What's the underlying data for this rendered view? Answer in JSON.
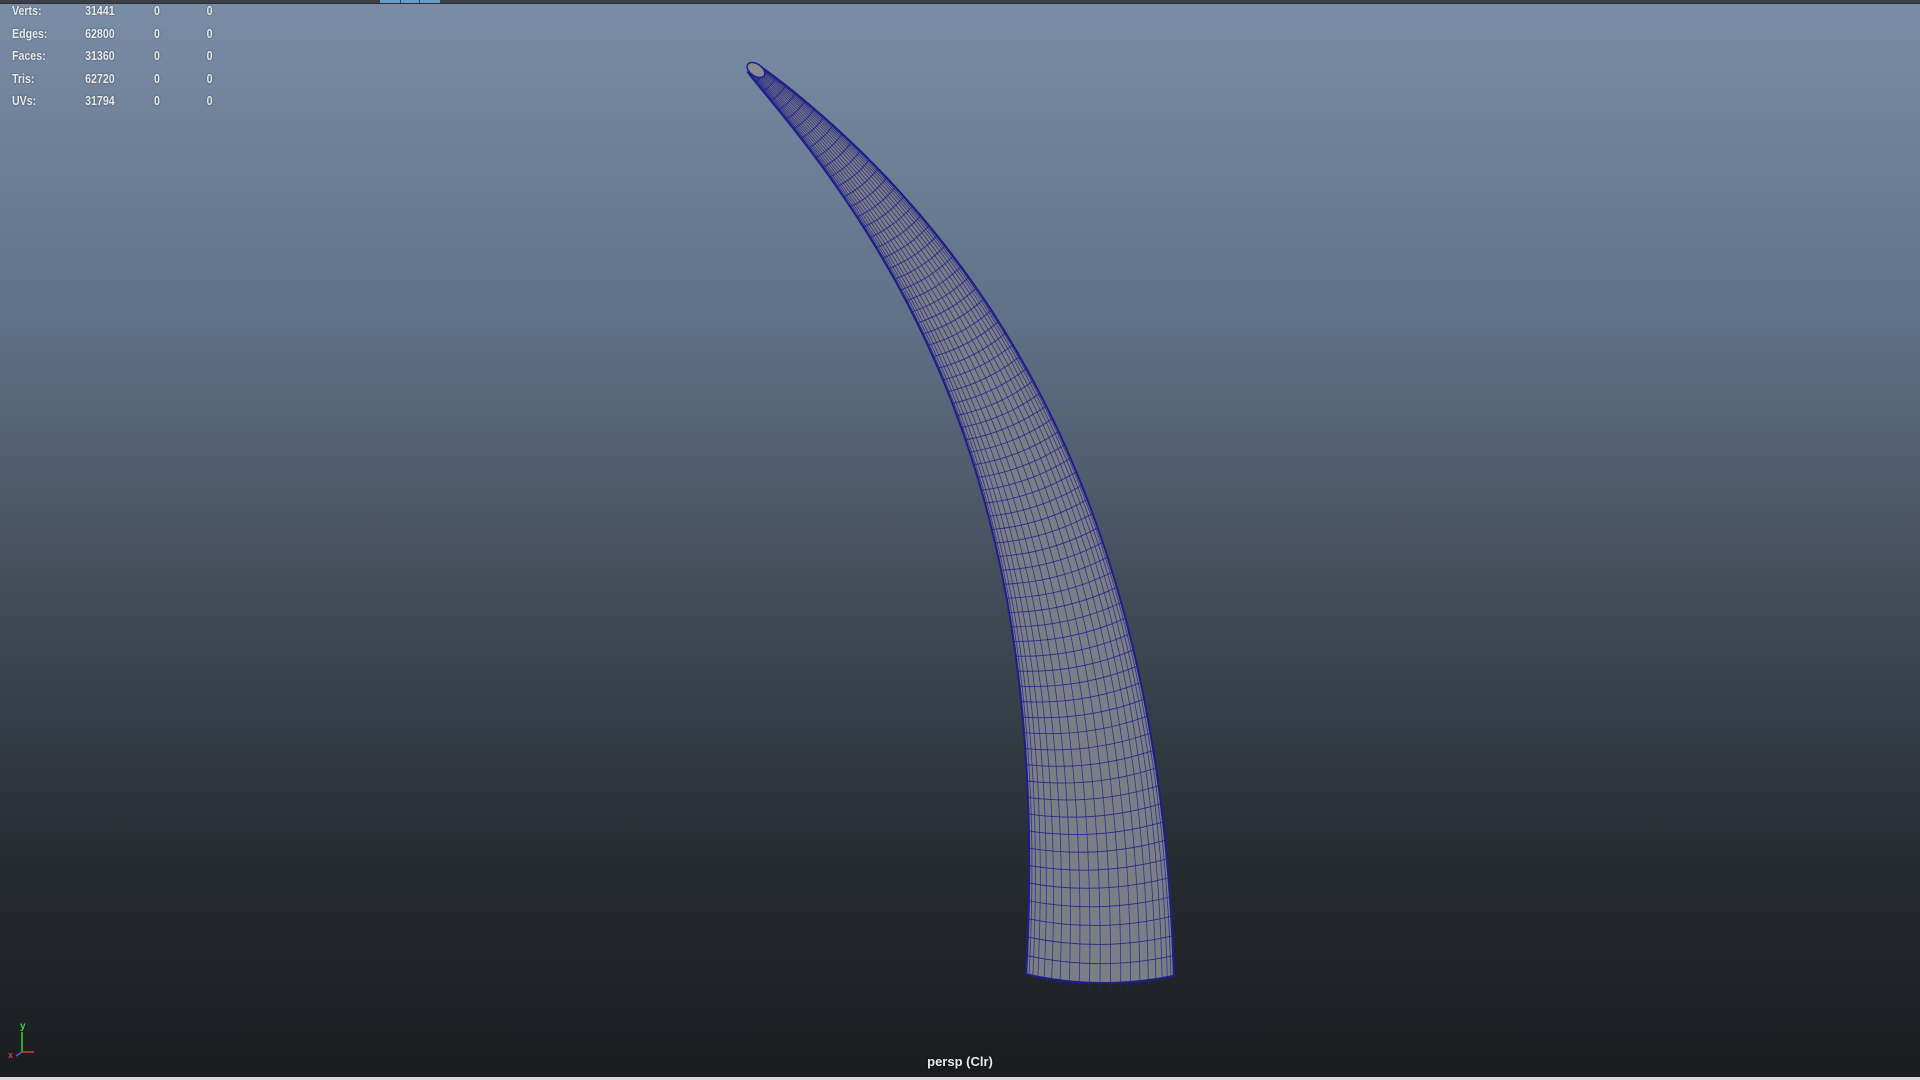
{
  "hud": {
    "rows": [
      {
        "label": "Verts:",
        "v1": "31441",
        "v2": "0",
        "v3": "0"
      },
      {
        "label": "Edges:",
        "v1": "62800",
        "v2": "0",
        "v3": "0"
      },
      {
        "label": "Faces:",
        "v1": "31360",
        "v2": "0",
        "v3": "0"
      },
      {
        "label": "Tris:",
        "v1": "62720",
        "v2": "0",
        "v3": "0"
      },
      {
        "label": "UVs:",
        "v1": "31794",
        "v2": "0",
        "v3": "0"
      }
    ]
  },
  "viewport": {
    "camera_label": "persp (Clr)",
    "axis_y_label": "y",
    "axis_x_label": "x"
  },
  "colors": {
    "wireframe": "#1e1f8a",
    "mesh_fill": "#7c7e86",
    "background_top": "#7a8da6",
    "background_bottom": "#1a1c1f"
  }
}
